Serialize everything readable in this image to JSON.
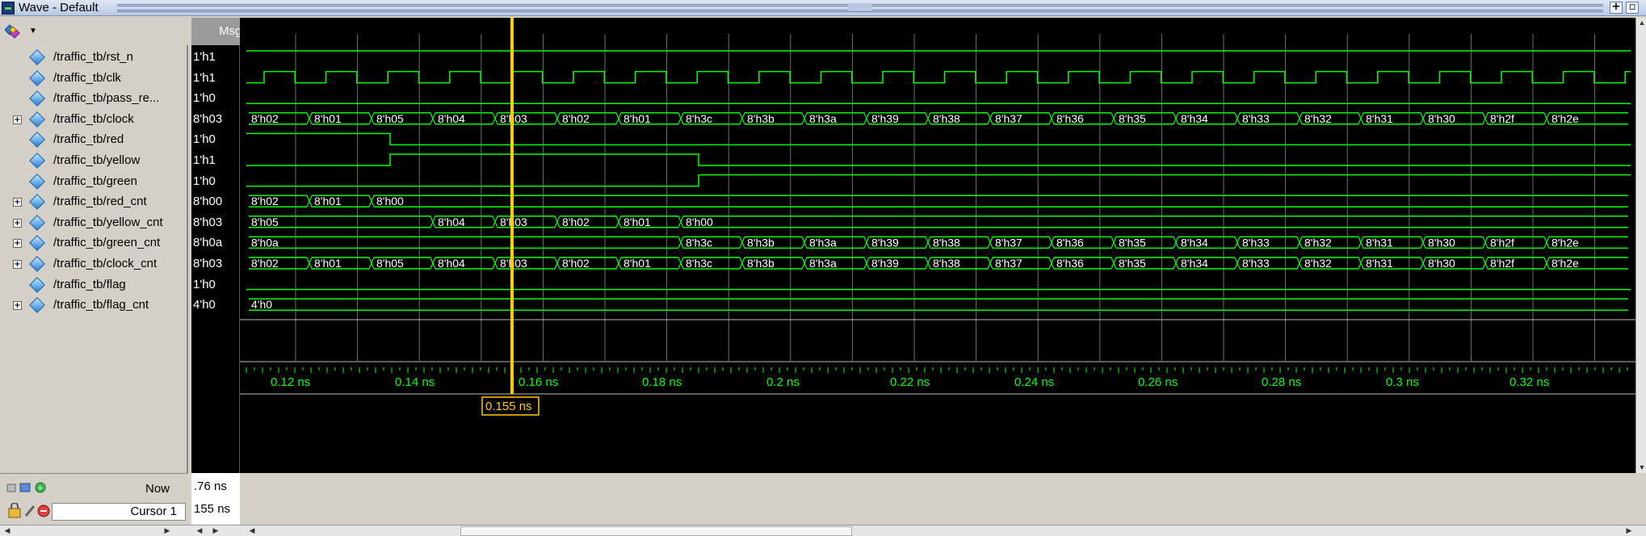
{
  "window": {
    "title": "Wave - Default"
  },
  "columns": {
    "msgs_header": "Msgs"
  },
  "signals": [
    {
      "name": "/traffic_tb/rst_n",
      "value": "1'h1",
      "expandable": false
    },
    {
      "name": "/traffic_tb/clk",
      "value": "1'h1",
      "expandable": false
    },
    {
      "name": "/traffic_tb/pass_re...",
      "value": "1'h0",
      "expandable": false
    },
    {
      "name": "/traffic_tb/clock",
      "value": "8'h03",
      "expandable": true
    },
    {
      "name": "/traffic_tb/red",
      "value": "1'h0",
      "expandable": false
    },
    {
      "name": "/traffic_tb/yellow",
      "value": "1'h1",
      "expandable": false
    },
    {
      "name": "/traffic_tb/green",
      "value": "1'h0",
      "expandable": false
    },
    {
      "name": "/traffic_tb/red_cnt",
      "value": "8'h00",
      "expandable": true
    },
    {
      "name": "/traffic_tb/yellow_cnt",
      "value": "8'h03",
      "expandable": true
    },
    {
      "name": "/traffic_tb/green_cnt",
      "value": "8'h0a",
      "expandable": true
    },
    {
      "name": "/traffic_tb/clock_cnt",
      "value": "8'h03",
      "expandable": true
    },
    {
      "name": "/traffic_tb/flag",
      "value": "1'h0",
      "expandable": false
    },
    {
      "name": "/traffic_tb/flag_cnt",
      "value": "4'h0",
      "expandable": true
    }
  ],
  "bus_values": {
    "clock": [
      "8'h02",
      "8'h01",
      "8'h05",
      "8'h04",
      "8'h03",
      "8'h02",
      "8'h01",
      "8'h3c",
      "8'h3b",
      "8'h3a",
      "8'h39",
      "8'h38",
      "8'h37",
      "8'h36",
      "8'h35",
      "8'h34",
      "8'h33",
      "8'h32",
      "8'h31",
      "8'h30",
      "8'h2f",
      "8'h2e"
    ],
    "red_cnt": [
      "8'h02",
      "8'h01",
      "8'h00"
    ],
    "yellow_cnt": [
      "8'h05",
      "8'h04",
      "8'h03",
      "8'h02",
      "8'h01",
      "8'h00"
    ],
    "green_cnt": [
      "8'h0a",
      "8'h3c",
      "8'h3b",
      "8'h3a",
      "8'h39",
      "8'h38",
      "8'h37",
      "8'h36",
      "8'h35",
      "8'h34",
      "8'h33",
      "8'h32",
      "8'h31",
      "8'h30",
      "8'h2f",
      "8'h2e"
    ],
    "clock_cnt": [
      "8'h02",
      "8'h01",
      "8'h05",
      "8'h04",
      "8'h03",
      "8'h02",
      "8'h01",
      "8'h3c",
      "8'h3b",
      "8'h3a",
      "8'h39",
      "8'h38",
      "8'h37",
      "8'h36",
      "8'h35",
      "8'h34",
      "8'h33",
      "8'h32",
      "8'h31",
      "8'h30",
      "8'h2f",
      "8'h2e"
    ],
    "flag_cnt": [
      "4'h0"
    ]
  },
  "timeline": {
    "ticks": [
      "0.12 ns",
      "0.14 ns",
      "0.16 ns",
      "0.18 ns",
      "0.2 ns",
      "0.22 ns",
      "0.24 ns",
      "0.26 ns",
      "0.28 ns",
      "0.3 ns",
      "0.32 ns"
    ],
    "cursor_time_label": "0.155 ns"
  },
  "footer": {
    "now_label": "Now",
    "now_value": ".76 ns",
    "cursor_label": "Cursor 1",
    "cursor_value": "155 ns"
  },
  "colors": {
    "wave": "#00ff00",
    "cursor": "#ffcc00",
    "background": "#000000"
  },
  "icons": {
    "toolbar": "wave-toolbar-icon",
    "signal": "diamond-signal-icon",
    "expand": "plus-expand-icon",
    "now_icons": "zoom-icons",
    "cursor_icons": "cursor-lock-icons"
  }
}
